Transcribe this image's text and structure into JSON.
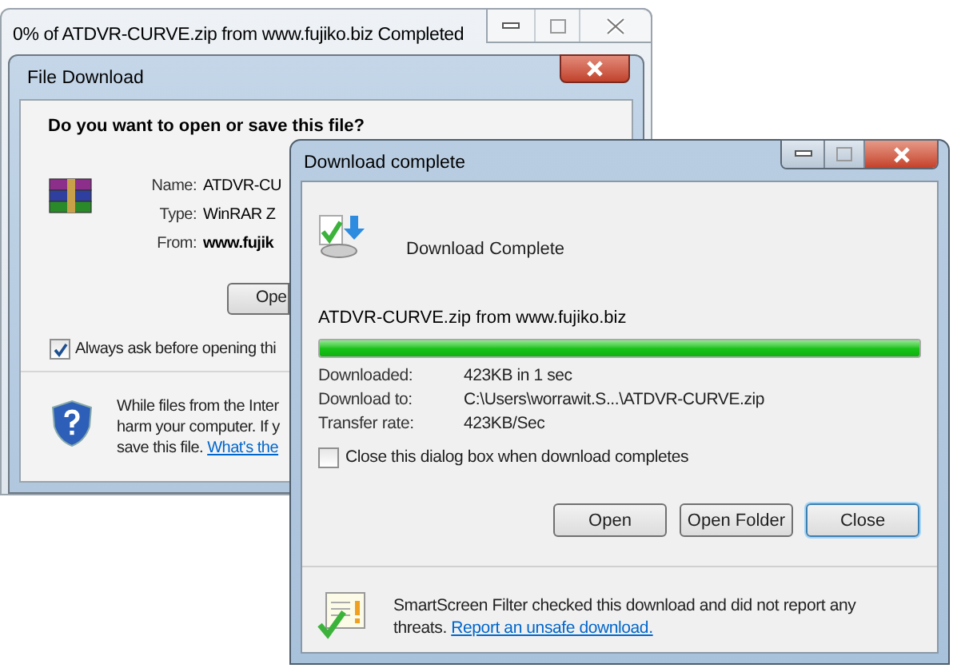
{
  "background_window": {
    "title": "0% of ATDVR-CURVE.zip from www.fujiko.biz Completed"
  },
  "file_download": {
    "title": "File Download",
    "question": "Do you want to open or save this file?",
    "fields": [
      {
        "label": "Name:",
        "value": "ATDVR-CU"
      },
      {
        "label": "Type:",
        "value": "WinRAR Z"
      },
      {
        "label": "From:",
        "value": "www.fujik"
      }
    ],
    "open_button": "Ope",
    "always_ask": {
      "label": "Always ask before opening thi",
      "checked": true
    },
    "warning": {
      "lines": [
        "While files from the Inter",
        "harm your computer. If y",
        "save this file."
      ],
      "link": "What's the"
    }
  },
  "download_complete": {
    "title": "Download complete",
    "heading": "Download Complete",
    "file": "ATDVR-CURVE.zip from www.fujiko.biz",
    "progress": {
      "level": 1
    },
    "details": [
      {
        "label": "Downloaded:",
        "value": "423KB in 1 sec"
      },
      {
        "label": "Download to:",
        "value": "C:\\Users\\worrawit.S...\\ATDVR-CURVE.zip"
      },
      {
        "label": "Transfer rate:",
        "value": "423KB/Sec"
      }
    ],
    "close_when_done": {
      "label": "Close this dialog box when download completes",
      "checked": false
    },
    "buttons": [
      {
        "label": "Open",
        "default": false
      },
      {
        "label": "Open Folder",
        "default": false
      },
      {
        "label": "Close",
        "default": true
      }
    ],
    "smartscreen": {
      "text": "SmartScreen Filter checked this download and did not report any threats.",
      "link": "Report an unsafe download."
    }
  }
}
